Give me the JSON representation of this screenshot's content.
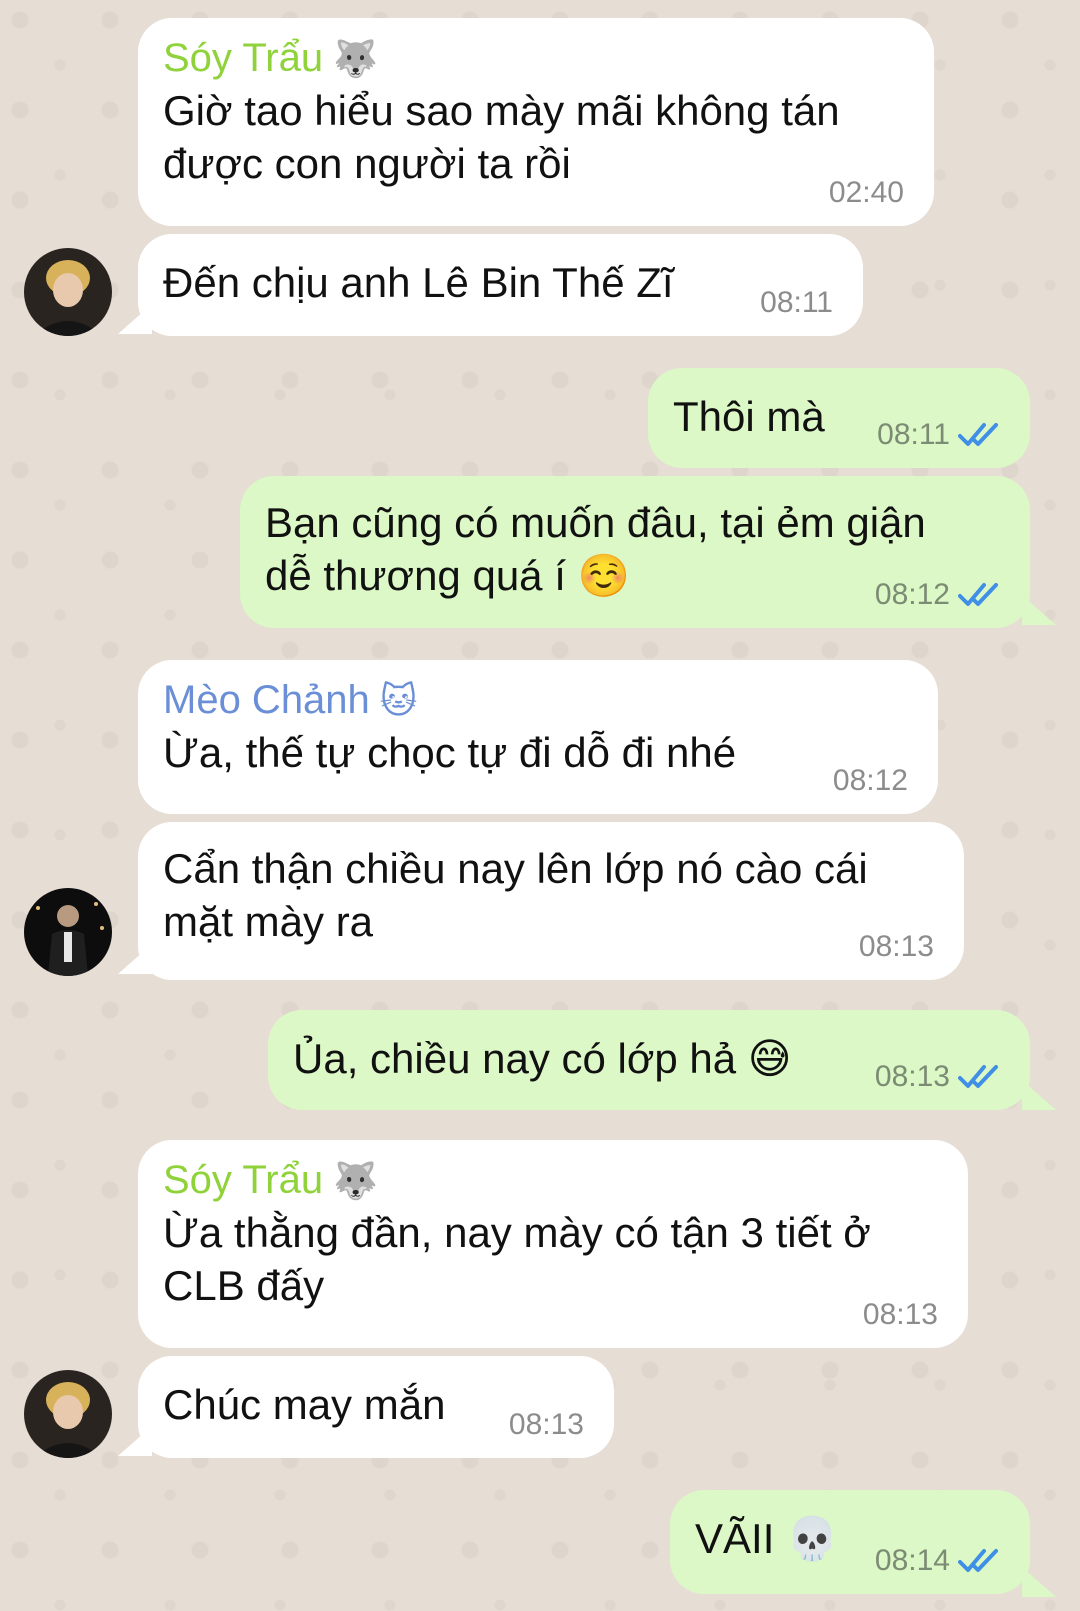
{
  "colors": {
    "incoming_bubble": "#ffffff",
    "outgoing_bubble": "#dcf8c6",
    "sender_green": "#8fd23a",
    "sender_blue": "#6b8fd6",
    "read_check": "#3f8fe6"
  },
  "messages": [
    {
      "sender": "Sóy Trẩu",
      "sender_emoji": "🐺",
      "text": "Giờ tao hiểu sao mày mãi không tán\nđược con người ta rồi",
      "time": "02:40"
    },
    {
      "text": "Đến chịu anh Lê Bin Thế Zĩ",
      "time": "08:11"
    },
    {
      "text": "Thôi mà",
      "time": "08:11"
    },
    {
      "text": "Bạn cũng có muốn đâu, tại ẻm giận\ndễ thương quá í ☺️",
      "time": "08:12"
    },
    {
      "sender": "Mèo Chảnh",
      "sender_emoji": "🐱",
      "text": "Ừa, thế tự chọc tự đi dỗ đi nhé",
      "time": "08:12"
    },
    {
      "text": "Cẩn thận chiều nay lên lớp nó cào cái\nmặt mày ra",
      "time": "08:13"
    },
    {
      "text": "Ủa, chiều nay có lớp hả 😅",
      "time": "08:13"
    },
    {
      "sender": "Sóy Trẩu",
      "sender_emoji": "🐺",
      "text": "Ừa thằng đần, nay mày có tận 3 tiết ở\nCLB đấy",
      "time": "08:13"
    },
    {
      "text": "Chúc may mắn",
      "time": "08:13"
    },
    {
      "text": "VÃII 💀",
      "time": "08:14"
    }
  ]
}
